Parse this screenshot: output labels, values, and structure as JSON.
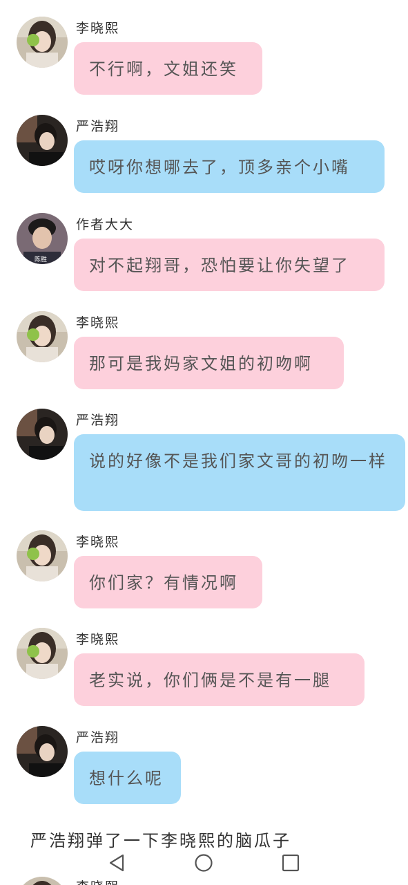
{
  "messages": [
    {
      "sender": "李晓熙",
      "text": "不行啊，文姐还笑",
      "color": "pink"
    },
    {
      "sender": "严浩翔",
      "text": "哎呀你想哪去了，顶多亲个小嘴",
      "color": "blue"
    },
    {
      "sender": "作者大大",
      "text": "对不起翔哥，恐怕要让你失望了",
      "color": "pink"
    },
    {
      "sender": "李晓熙",
      "text": "那可是我妈家文姐的初吻啊",
      "color": "pink"
    },
    {
      "sender": "严浩翔",
      "text": "说的好像不是我们家文哥的初吻一样",
      "color": "blue"
    },
    {
      "sender": "李晓熙",
      "text": "你们家？有情况啊",
      "color": "pink"
    },
    {
      "sender": "李晓熙",
      "text": "老实说，你们俩是不是有一腿",
      "color": "pink"
    },
    {
      "sender": "严浩翔",
      "text": "想什么呢",
      "color": "blue"
    }
  ],
  "narration": "严浩翔弹了一下李晓熙的脑瓜子",
  "peek_sender": "李晓熙",
  "avatar_text": "陈胜",
  "colors": {
    "pink_bubble": "#fdd0dc",
    "blue_bubble": "#a8ddf9"
  },
  "navbar": {
    "icons": [
      "back-triangle-icon",
      "home-circle-icon",
      "recents-square-icon"
    ]
  }
}
